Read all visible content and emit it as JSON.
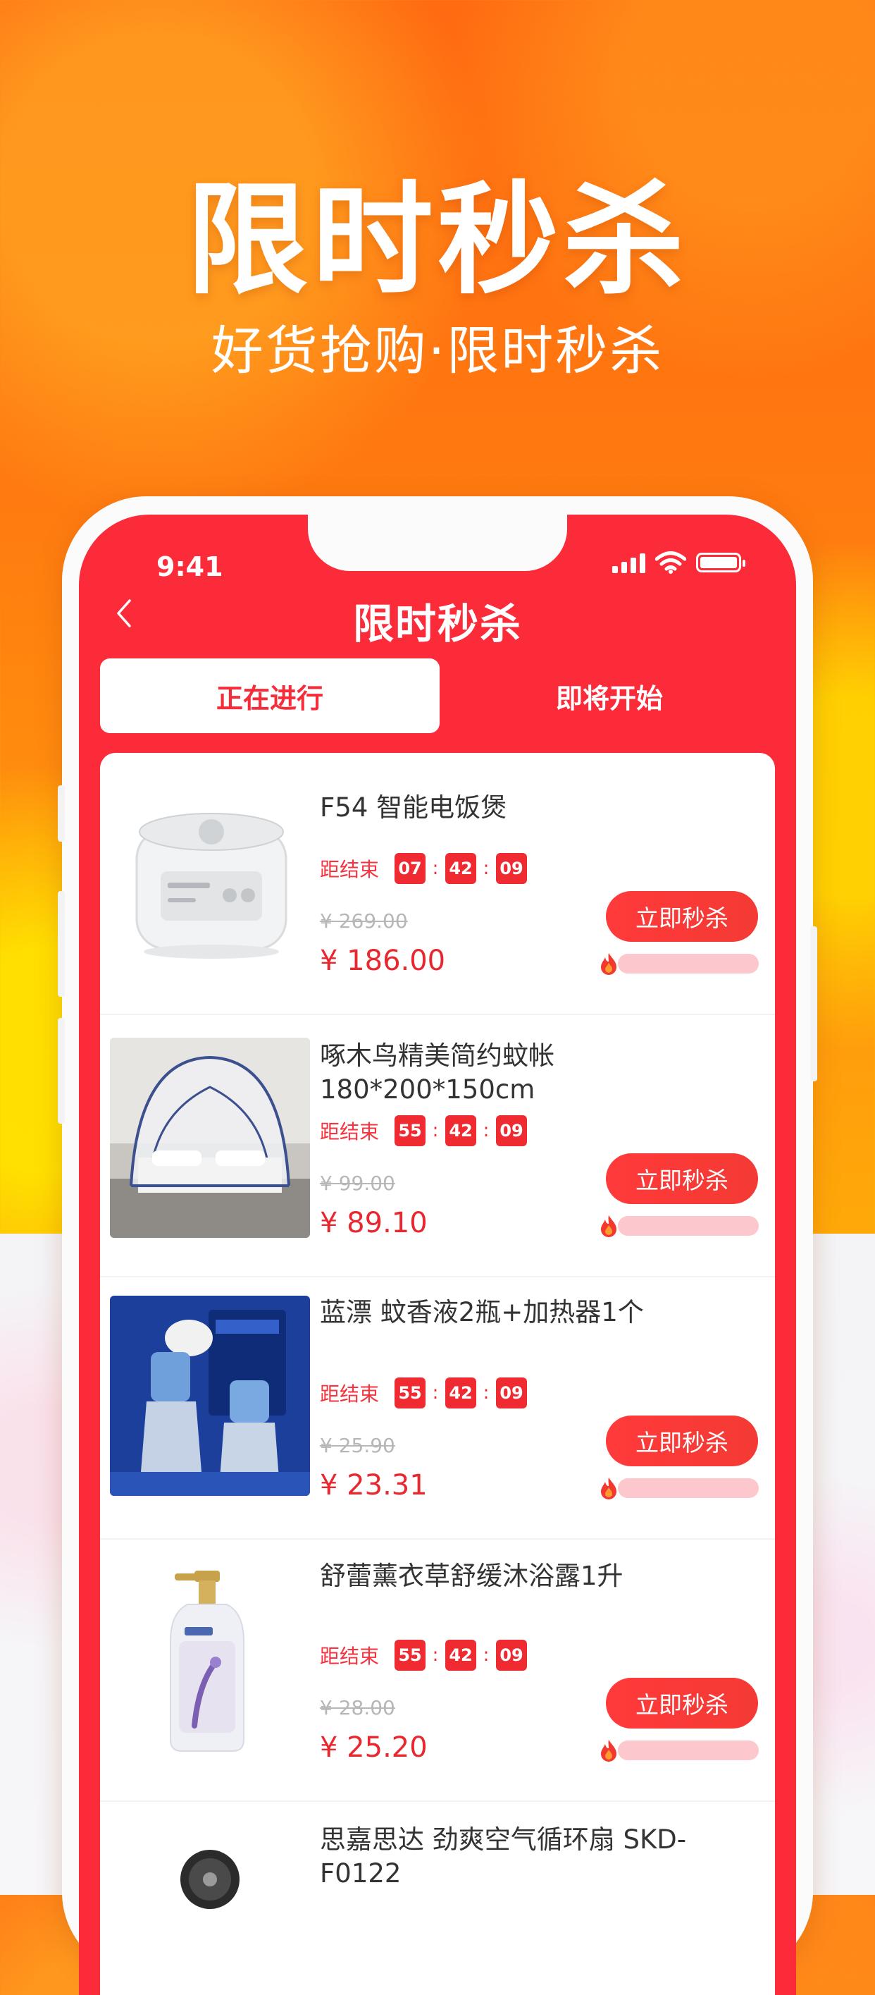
{
  "hero": {
    "title": "限时秒杀",
    "subtitle": "好货抢购·限时秒杀"
  },
  "status_bar": {
    "time": "9:41",
    "icons": [
      "signal-icon",
      "wifi-icon",
      "battery-icon"
    ]
  },
  "nav": {
    "back_icon": "chevron-left-icon",
    "title": "限时秒杀"
  },
  "tabs": [
    {
      "label": "正在进行",
      "active": true
    },
    {
      "label": "即将开始",
      "active": false
    }
  ],
  "colors": {
    "brand_red": "#fb2b39",
    "price_red": "#e8272f",
    "orange": "#ff7a10"
  },
  "products": [
    {
      "title": "F54 智能电饭煲",
      "countdown_label": "距结束",
      "countdown": [
        "07",
        "42",
        "09"
      ],
      "old_price": "¥ 269.00",
      "price": "¥ 186.00",
      "buy_label": "立即秒杀",
      "image": "rice-cooker",
      "sold_progress": 0
    },
    {
      "title": "啄木鸟精美简约蚊帐180*200*150cm",
      "countdown_label": "距结束",
      "countdown": [
        "55",
        "42",
        "09"
      ],
      "old_price": "¥ 99.00",
      "price": "¥ 89.10",
      "buy_label": "立即秒杀",
      "image": "mosquito-net",
      "sold_progress": 0
    },
    {
      "title": "蓝漂 蚊香液2瓶+加热器1个",
      "countdown_label": "距结束",
      "countdown": [
        "55",
        "42",
        "09"
      ],
      "old_price": "¥ 25.90",
      "price": "¥ 23.31",
      "buy_label": "立即秒杀",
      "image": "mosquito-liquid",
      "sold_progress": 0
    },
    {
      "title": "舒蕾薰衣草舒缓沐浴露1升",
      "countdown_label": "距结束",
      "countdown": [
        "55",
        "42",
        "09"
      ],
      "old_price": "¥ 28.00",
      "price": "¥ 25.20",
      "buy_label": "立即秒杀",
      "image": "body-wash",
      "sold_progress": 0
    },
    {
      "title": "思嘉思达 劲爽空气循环扇 SKD-F0122",
      "image": "air-fan"
    }
  ]
}
